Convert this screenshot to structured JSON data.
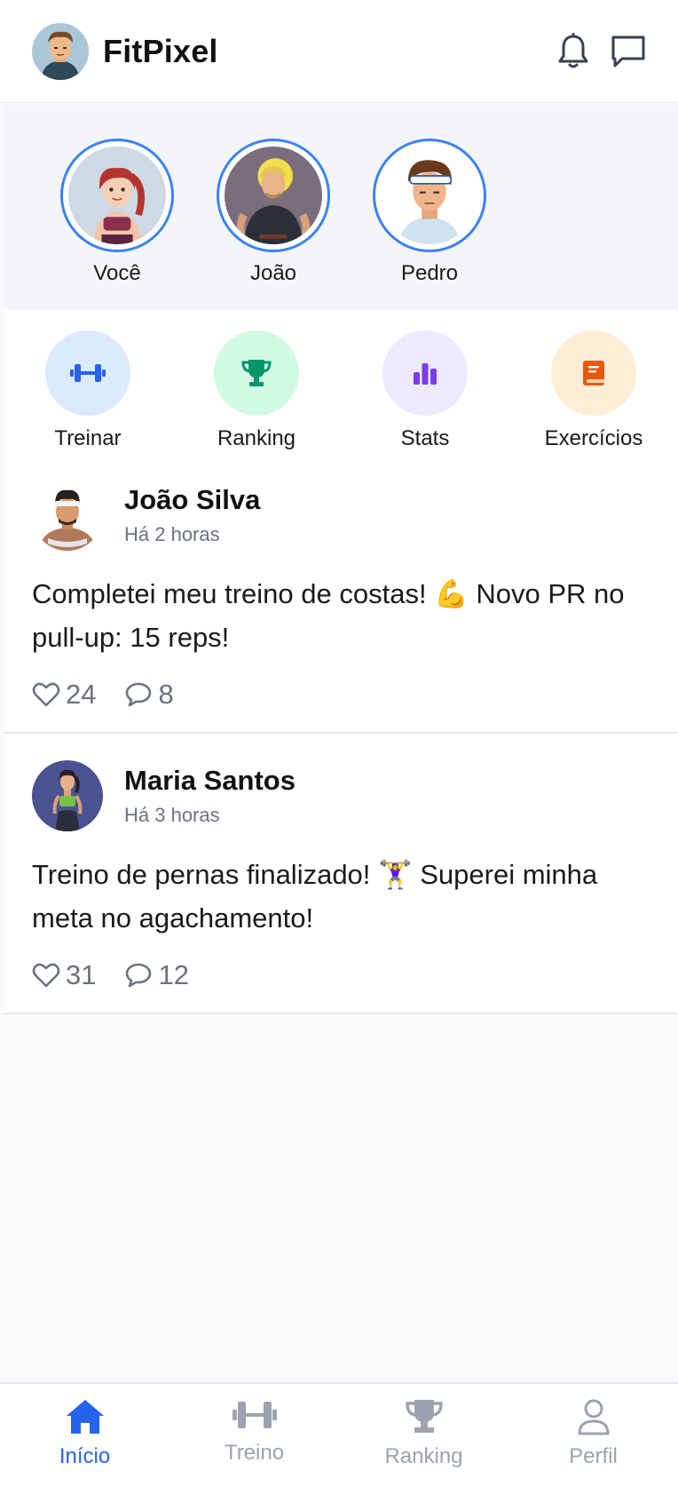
{
  "header": {
    "title": "FitPixel",
    "icons": [
      "bell-icon",
      "chat-icon"
    ]
  },
  "stories": [
    {
      "label": "Você",
      "avatar": "avatar-woman-red-hair"
    },
    {
      "label": "João",
      "avatar": "avatar-blond-man"
    },
    {
      "label": "Pedro",
      "avatar": "avatar-headband-man"
    }
  ],
  "actions": [
    {
      "label": "Treinar",
      "icon": "dumbbell-icon",
      "bg": "#dbeafe",
      "fg": "#2563eb"
    },
    {
      "label": "Ranking",
      "icon": "trophy-icon",
      "bg": "#d1fae5",
      "fg": "#059669"
    },
    {
      "label": "Stats",
      "icon": "bar-chart-icon",
      "bg": "#ede9fe",
      "fg": "#7c3aed"
    },
    {
      "label": "Exercícios",
      "icon": "book-icon",
      "bg": "#ffedd5",
      "fg": "#ea580c"
    }
  ],
  "posts": [
    {
      "name": "João Silva",
      "time": "Há 2 horas",
      "text": "Completei meu treino de costas! 💪 Novo PR no pull-up: 15 reps!",
      "likes": "24",
      "comments": "8"
    },
    {
      "name": "Maria Santos",
      "time": "Há 3 horas",
      "text": "Treino de pernas finalizado! 🏋️‍♀️ Superei minha meta no agachamento!",
      "likes": "31",
      "comments": "12"
    }
  ],
  "nav": [
    {
      "label": "Início",
      "icon": "home-icon",
      "active": true
    },
    {
      "label": "Treino",
      "icon": "dumbbell-icon",
      "active": false
    },
    {
      "label": "Ranking",
      "icon": "trophy-icon",
      "active": false
    },
    {
      "label": "Perfil",
      "icon": "user-icon",
      "active": false
    }
  ],
  "colors": {
    "accent": "#2563eb",
    "story_ring": "#3b82f6",
    "muted": "#6b7280",
    "nav_inactive": "#9ca3af"
  }
}
